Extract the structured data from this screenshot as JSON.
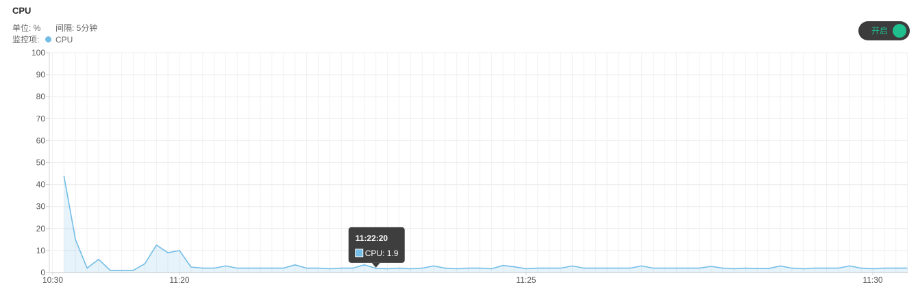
{
  "panel": {
    "unit_label": "单位: %",
    "interval_label": "间隔: 5分钟",
    "metric_label": "监控项:"
  },
  "toggle": {
    "label": "开启",
    "on": true,
    "color": "#1fbf8e"
  },
  "chart_data": {
    "type": "area",
    "title": "CPU",
    "x": [
      "11:18:20",
      "11:18:30",
      "11:18:40",
      "11:18:50",
      "11:19:00",
      "11:19:10",
      "11:19:20",
      "11:19:30",
      "11:19:40",
      "11:19:50",
      "11:20:00",
      "11:20:10",
      "11:20:20",
      "11:20:30",
      "11:20:40",
      "11:20:50",
      "11:21:00",
      "11:21:10",
      "11:21:20",
      "11:21:30",
      "11:21:40",
      "11:21:50",
      "11:22:00",
      "11:22:10",
      "11:22:20",
      "11:22:30",
      "11:22:40",
      "11:22:50",
      "11:23:00",
      "11:23:10",
      "11:23:20",
      "11:23:30",
      "11:23:40",
      "11:23:50",
      "11:24:00",
      "11:24:10",
      "11:24:20",
      "11:24:30",
      "11:24:40",
      "11:24:50",
      "11:25:00",
      "11:25:10",
      "11:25:20",
      "11:25:30",
      "11:25:40",
      "11:25:50",
      "11:26:00",
      "11:26:10",
      "11:26:20",
      "11:26:30",
      "11:26:40",
      "11:26:50",
      "11:27:00",
      "11:27:10",
      "11:27:20",
      "11:27:30",
      "11:27:40",
      "11:27:50",
      "11:28:00",
      "11:28:10",
      "11:28:20",
      "11:28:30",
      "11:28:40",
      "11:28:50",
      "11:29:00",
      "11:29:10",
      "11:29:20",
      "11:29:30",
      "11:29:40",
      "11:29:50",
      "11:30:00",
      "11:30:10",
      "11:30:20",
      "11:30:30"
    ],
    "series": [
      {
        "name": "CPU",
        "color": "#73bde6",
        "values": [
          44,
          15,
          2,
          6,
          1,
          1,
          1,
          4,
          12.5,
          9,
          10,
          2.5,
          2,
          2,
          3,
          2,
          2,
          2,
          2,
          2,
          3.5,
          2,
          2,
          1.7,
          2,
          2,
          3.5,
          1.9,
          1.7,
          2,
          1.7,
          2,
          3,
          2,
          1.7,
          2,
          2,
          1.7,
          3.2,
          2.6,
          1.7,
          2,
          2,
          2,
          3,
          2,
          2,
          2,
          2,
          2,
          3,
          2,
          2,
          2,
          2,
          2,
          2.8,
          2,
          1.7,
          2,
          1.8,
          1.8,
          3,
          2,
          1.7,
          2,
          2,
          2,
          3,
          2,
          1.7,
          2,
          2,
          2
        ]
      }
    ],
    "ylim": [
      0,
      100
    ],
    "y_ticks": [
      0,
      10,
      20,
      30,
      40,
      50,
      60,
      70,
      80,
      90,
      100
    ],
    "x_tick_labels": [
      "10:30",
      "11:20",
      "11:25",
      "11:30"
    ],
    "grid": true,
    "legend": "top-left",
    "tooltip": {
      "title": "11:22:20",
      "label": "CPU: 1.9"
    }
  }
}
